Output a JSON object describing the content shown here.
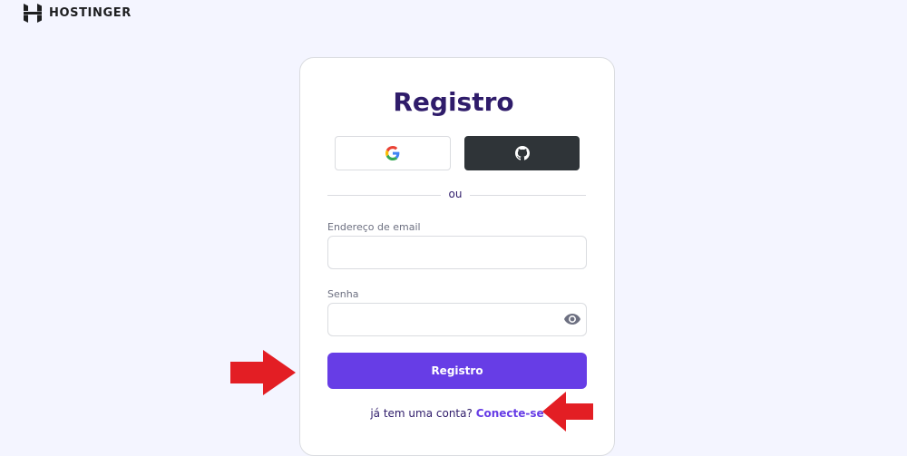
{
  "brand": {
    "name": "HOSTINGER"
  },
  "form": {
    "title": "Registro",
    "social": {
      "google_icon": "google-icon",
      "github_icon": "github-icon"
    },
    "divider_text": "ou",
    "email_label": "Endereço de email",
    "email_value": "",
    "password_label": "Senha",
    "password_value": "",
    "submit_label": "Registro",
    "login_prompt": "já tem uma conta?",
    "login_link": "Conecte-se"
  },
  "annotations": {
    "arrow_color": "#e31e24",
    "arrows": [
      "red-arrow-right-pointing",
      "red-arrow-left-pointing"
    ]
  },
  "colors": {
    "accent": "#673de6",
    "title": "#2f1c6a",
    "background": "#f4f5ff",
    "github_bg": "#2f3438"
  }
}
